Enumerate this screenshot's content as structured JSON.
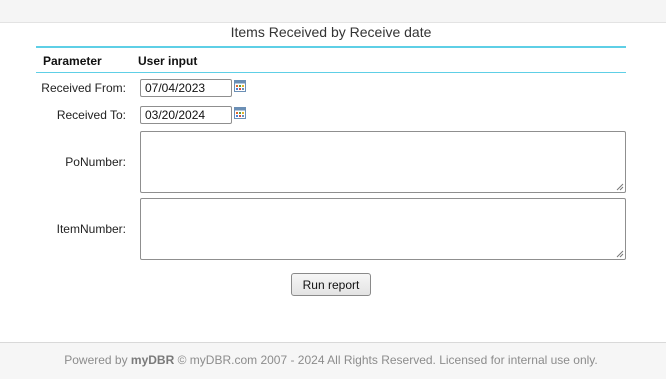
{
  "report": {
    "title": "Items Received by Receive date"
  },
  "table_header": {
    "parameter": "Parameter",
    "user_input": "User input"
  },
  "params": {
    "received_from": {
      "label": "Received From:",
      "value": "07/04/2023",
      "icon": "calendar-icon"
    },
    "received_to": {
      "label": "Received To:",
      "value": "03/20/2024",
      "icon": "calendar-icon"
    },
    "po_number": {
      "label": "PoNumber:",
      "value": ""
    },
    "item_number": {
      "label": "ItemNumber:",
      "value": ""
    }
  },
  "actions": {
    "run_report": "Run report"
  },
  "footer": {
    "powered_by": "Powered by ",
    "brand": "myDBR",
    "rest": " © myDBR.com 2007 - 2024 All Rights Reserved. Licensed for internal use only."
  },
  "colors": {
    "header_rule": "#5ecfe6",
    "footer_text": "#8c8c8c"
  }
}
